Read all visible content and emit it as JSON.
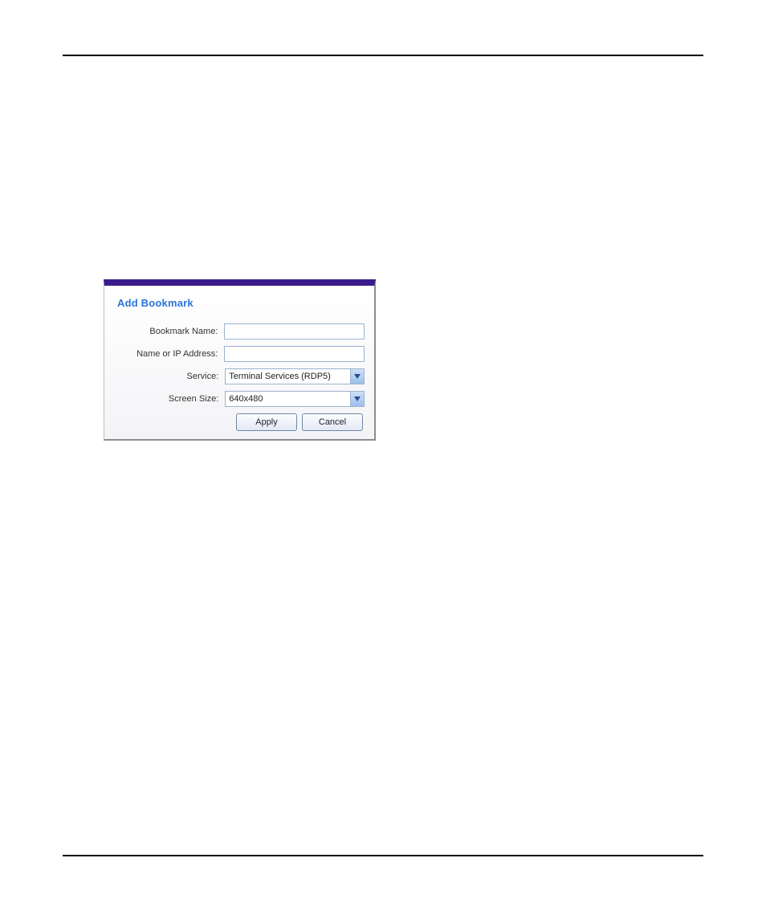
{
  "dialog": {
    "title": "Add Bookmark",
    "fields": {
      "bookmarkName": {
        "label": "Bookmark Name:",
        "value": ""
      },
      "nameOrIp": {
        "label": "Name or IP Address:",
        "value": ""
      },
      "service": {
        "label": "Service:",
        "selected": "Terminal Services (RDP5)"
      },
      "screenSize": {
        "label": "Screen Size:",
        "selected": "640x480"
      }
    },
    "buttons": {
      "apply": "Apply",
      "cancel": "Cancel"
    }
  }
}
